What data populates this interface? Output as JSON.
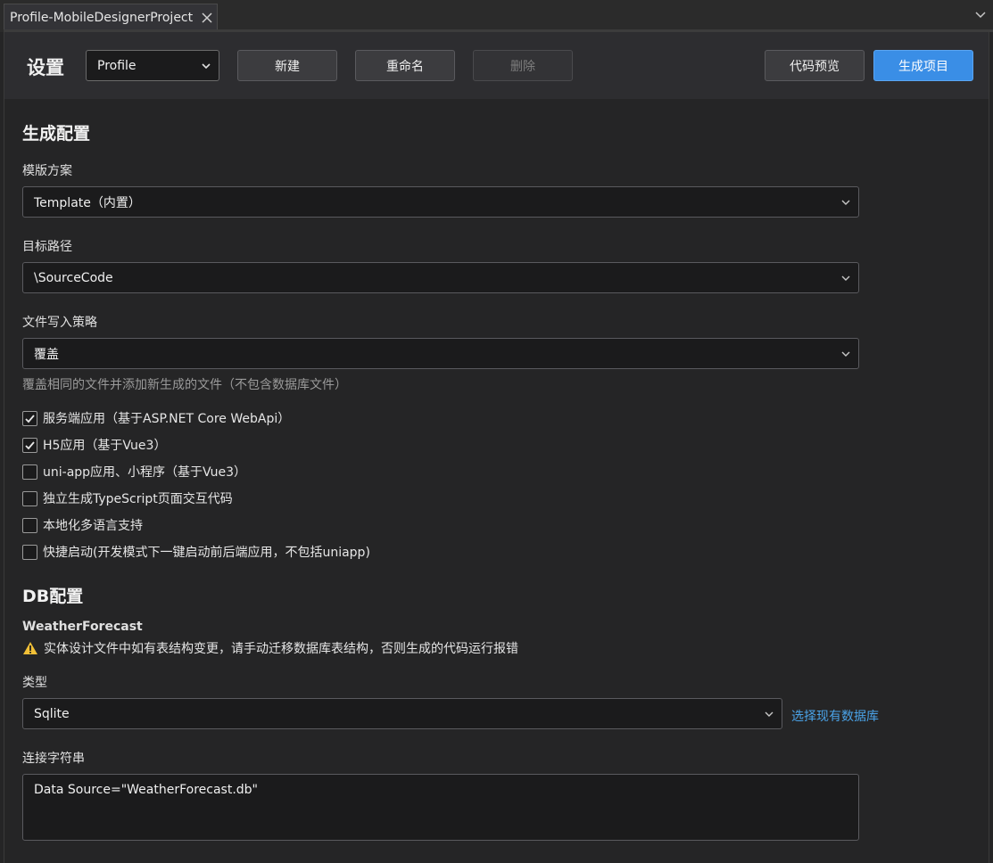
{
  "tab": {
    "title": "Profile-MobileDesignerProject"
  },
  "toolbar": {
    "heading": "设置",
    "profile_value": "Profile",
    "new_label": "新建",
    "rename_label": "重命名",
    "delete_label": "删除",
    "preview_label": "代码预览",
    "generate_label": "生成项目"
  },
  "gen": {
    "title": "生成配置",
    "template_label": "模版方案",
    "template_value": "Template（内置）",
    "path_label": "目标路径",
    "path_value": "\\SourceCode",
    "strategy_label": "文件写入策略",
    "strategy_value": "覆盖",
    "strategy_hint": "覆盖相同的文件并添加新生成的文件（不包含数据库文件）",
    "options": [
      {
        "label": "服务端应用（基于ASP.NET Core WebApi）",
        "checked": true
      },
      {
        "label": "H5应用（基于Vue3）",
        "checked": true
      },
      {
        "label": "uni-app应用、小程序（基于Vue3）",
        "checked": false
      },
      {
        "label": "独立生成TypeScript页面交互代码",
        "checked": false
      },
      {
        "label": "本地化多语言支持",
        "checked": false
      },
      {
        "label": "快捷启动(开发模式下一键启动前后端应用，不包括uniapp)",
        "checked": false
      }
    ]
  },
  "db": {
    "title": "DB配置",
    "entity": "WeatherForecast",
    "warning": "实体设计文件中如有表结构变更，请手动迁移数据库表结构，否则生成的代码运行报错",
    "type_label": "类型",
    "type_value": "Sqlite",
    "select_existing": "选择现有数据库",
    "conn_label": "连接字符串",
    "conn_value": "Data Source=\"WeatherForecast.db\""
  },
  "colors": {
    "accent": "#3a8ee6",
    "link": "#4aa3e8",
    "warning": "#f2c037"
  }
}
